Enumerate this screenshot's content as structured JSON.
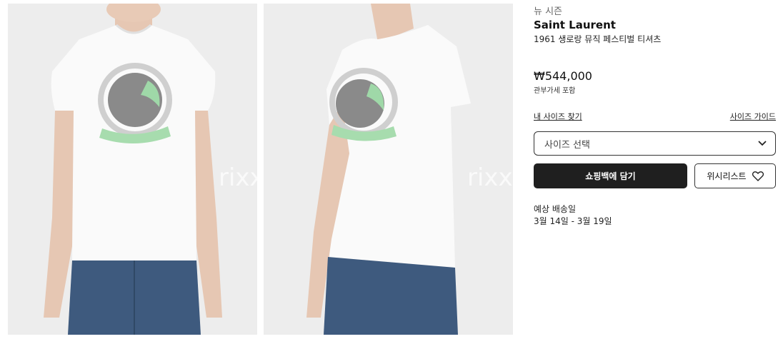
{
  "product": {
    "season": "뉴 시즌",
    "brand": "Saint Laurent",
    "name": "1961 생로랑 뮤직 페스티벌 티셔츠",
    "price": "₩544,000",
    "duty_note": "관부가세 포함"
  },
  "size": {
    "find_my_size": "내 사이즈 찾기",
    "size_guide": "사이즈 가이드",
    "select_placeholder": "사이즈 선택"
  },
  "actions": {
    "add_to_cart": "쇼핑백에 담기",
    "wishlist": "위시리스트"
  },
  "delivery": {
    "title": "예상 배송일",
    "dates": "3월 14일 - 3월 19일"
  },
  "images": [
    {
      "view": "front",
      "watermark": "rixx"
    },
    {
      "view": "side",
      "watermark": "rixx"
    }
  ]
}
